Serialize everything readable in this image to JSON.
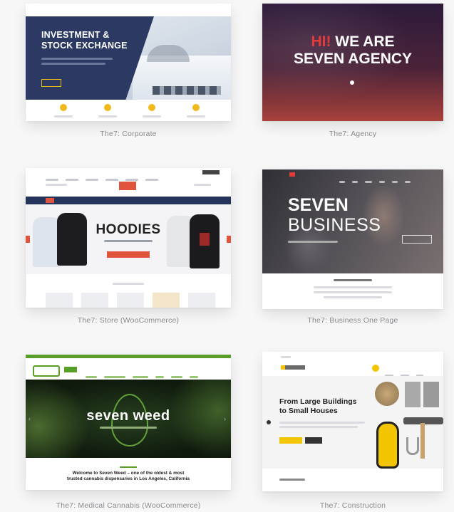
{
  "colors": {
    "background": "#f7f7f8",
    "caption": "#8a8a8e",
    "corporate_navy": "#2c3a63",
    "corporate_yellow": "#f0b91b",
    "agency_purple": "#3a2040",
    "agency_red": "#e23b3b",
    "store_navy": "#23335a",
    "store_red": "#e0533d",
    "business_gray": "#3f3f44",
    "medical_green": "#5a9e2a",
    "construction_yellow": "#f3c400"
  },
  "templates": [
    {
      "caption": "The7: Corporate",
      "hero_line1": "INVESTMENT &",
      "hero_line2": "STOCK EXCHANGE"
    },
    {
      "caption": "The7: Agency",
      "hero_hi": "HI!",
      "hero_we_are": " WE ARE",
      "hero_line2": "SEVEN AGENCY"
    },
    {
      "caption": "The7: Store (WooCommerce)",
      "hero_title": "HOODIES"
    },
    {
      "caption": "The7: Business One Page",
      "hero_line1": "SEVEN",
      "hero_line2": "BUSINESS"
    },
    {
      "caption": "The7: Medical Cannabis (WooCommerce)",
      "hero_title": "seven weed",
      "intro_line1": "Welcome to Seven Weed – one of the oldest & most",
      "intro_line2": "trusted cannabis dispensaries in Los Angeles, California"
    },
    {
      "caption": "The7: Construction",
      "hero_line1": "From Large Buildings",
      "hero_line2": "to Small Houses"
    }
  ]
}
